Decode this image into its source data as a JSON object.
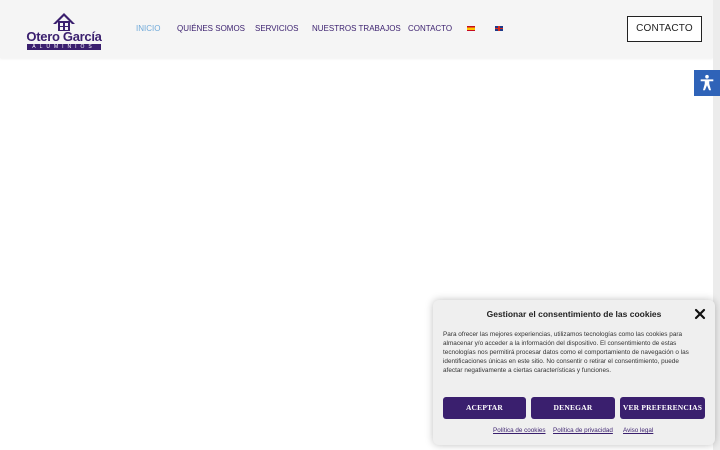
{
  "brand": {
    "name": "Otero García",
    "sub": "ALUMINIOS",
    "primary_color": "#3a1f6e",
    "active_color": "#6fa9d9"
  },
  "nav": {
    "items": [
      {
        "label": "INICIO",
        "active": true
      },
      {
        "label": "QUIÉNES SOMOS",
        "active": false
      },
      {
        "label": "SERVICIOS",
        "active": false
      },
      {
        "label": "NUESTROS TRABAJOS",
        "active": false
      },
      {
        "label": "CONTACTO",
        "active": false
      }
    ],
    "languages": [
      "es-flag-icon",
      "en-flag-icon"
    ]
  },
  "header_button": {
    "label": "CONTACTO"
  },
  "accessibility": {
    "icon": "accessibility-icon",
    "color": "#2f63b8"
  },
  "cookie_banner": {
    "title": "Gestionar el consentimiento de las cookies",
    "text": "Para ofrecer las mejores experiencias, utilizamos tecnologías como las cookies para almacenar y/o acceder a la información del dispositivo. El consentimiento de estas tecnologías nos permitirá procesar datos como el comportamiento de navegación o las identificaciones únicas en este sitio. No consentir o retirar el consentimiento, puede afectar negativamente a ciertas características y funciones.",
    "buttons": {
      "accept": "ACEPTAR",
      "deny": "DENEGAR",
      "preferences": "VER PREFERENCIAS"
    },
    "links": {
      "cookies": "Política de cookies",
      "privacy": "Política de privacidad",
      "legal": "Aviso legal"
    }
  }
}
